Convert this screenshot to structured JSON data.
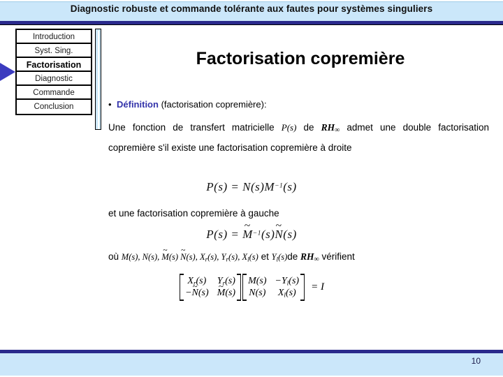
{
  "header": {
    "title": "Diagnostic robuste et commande tolérante aux fautes pour systèmes singuliers",
    "band_color": "#cbe7fa",
    "rule_color": "#2a2a8c"
  },
  "sidebar": {
    "arrow_icon": "triangle-right-icon",
    "arrow_color": "#3b3bbf",
    "current_index": 2,
    "items": [
      {
        "label": "Introduction"
      },
      {
        "label": "Syst. Sing."
      },
      {
        "label": "Factorisation"
      },
      {
        "label": "Diagnostic"
      },
      {
        "label": "Commande"
      },
      {
        "label": "Conclusion"
      }
    ]
  },
  "slide": {
    "title": "Factorisation copremière",
    "bullet": {
      "marker": "•",
      "keyword": "Définition",
      "keyword_color": "#3333aa",
      "rest": "(factorisation copremière):"
    },
    "definition": {
      "t1": "Une fonction de transfert matricielle ",
      "var_p": "P(s)",
      "t2": " de ",
      "space_rh": "RH",
      "space_rh_sub": "∞",
      "t3": " admet une double factorisation copremière s'il existe une factorisation copremière à droite"
    },
    "equation_right": "P(s) = N(s)M⁻¹(s)",
    "line_left": "et une factorisation copremière à gauche",
    "equation_left": "P(s) = M̃⁻¹(s)Ñ(s)",
    "where_line": {
      "prefix": "où ",
      "vars": "M(s), N(s), M̃(s), Ñ(s), Xr(s), Yr(s), Xl(s)",
      "conj": " et ",
      "last_var": "Yl(s)",
      "mid": "de ",
      "space_rh": "RH",
      "space_rh_sub": "∞",
      "suffix": " vérifient"
    },
    "matrix_equation": {
      "left_matrix": [
        [
          "Xr(s)",
          "Yr(s)"
        ],
        [
          "−Ñ(s)",
          "M̃(s)"
        ]
      ],
      "right_matrix": [
        [
          "M(s)",
          "−Yl(s)"
        ],
        [
          "N(s)",
          "Xl(s)"
        ]
      ],
      "equals": "=",
      "result": "I"
    }
  },
  "footer": {
    "page_number": "10",
    "band_color": "#cbe7fa",
    "rule_color": "#2a2a8c"
  }
}
